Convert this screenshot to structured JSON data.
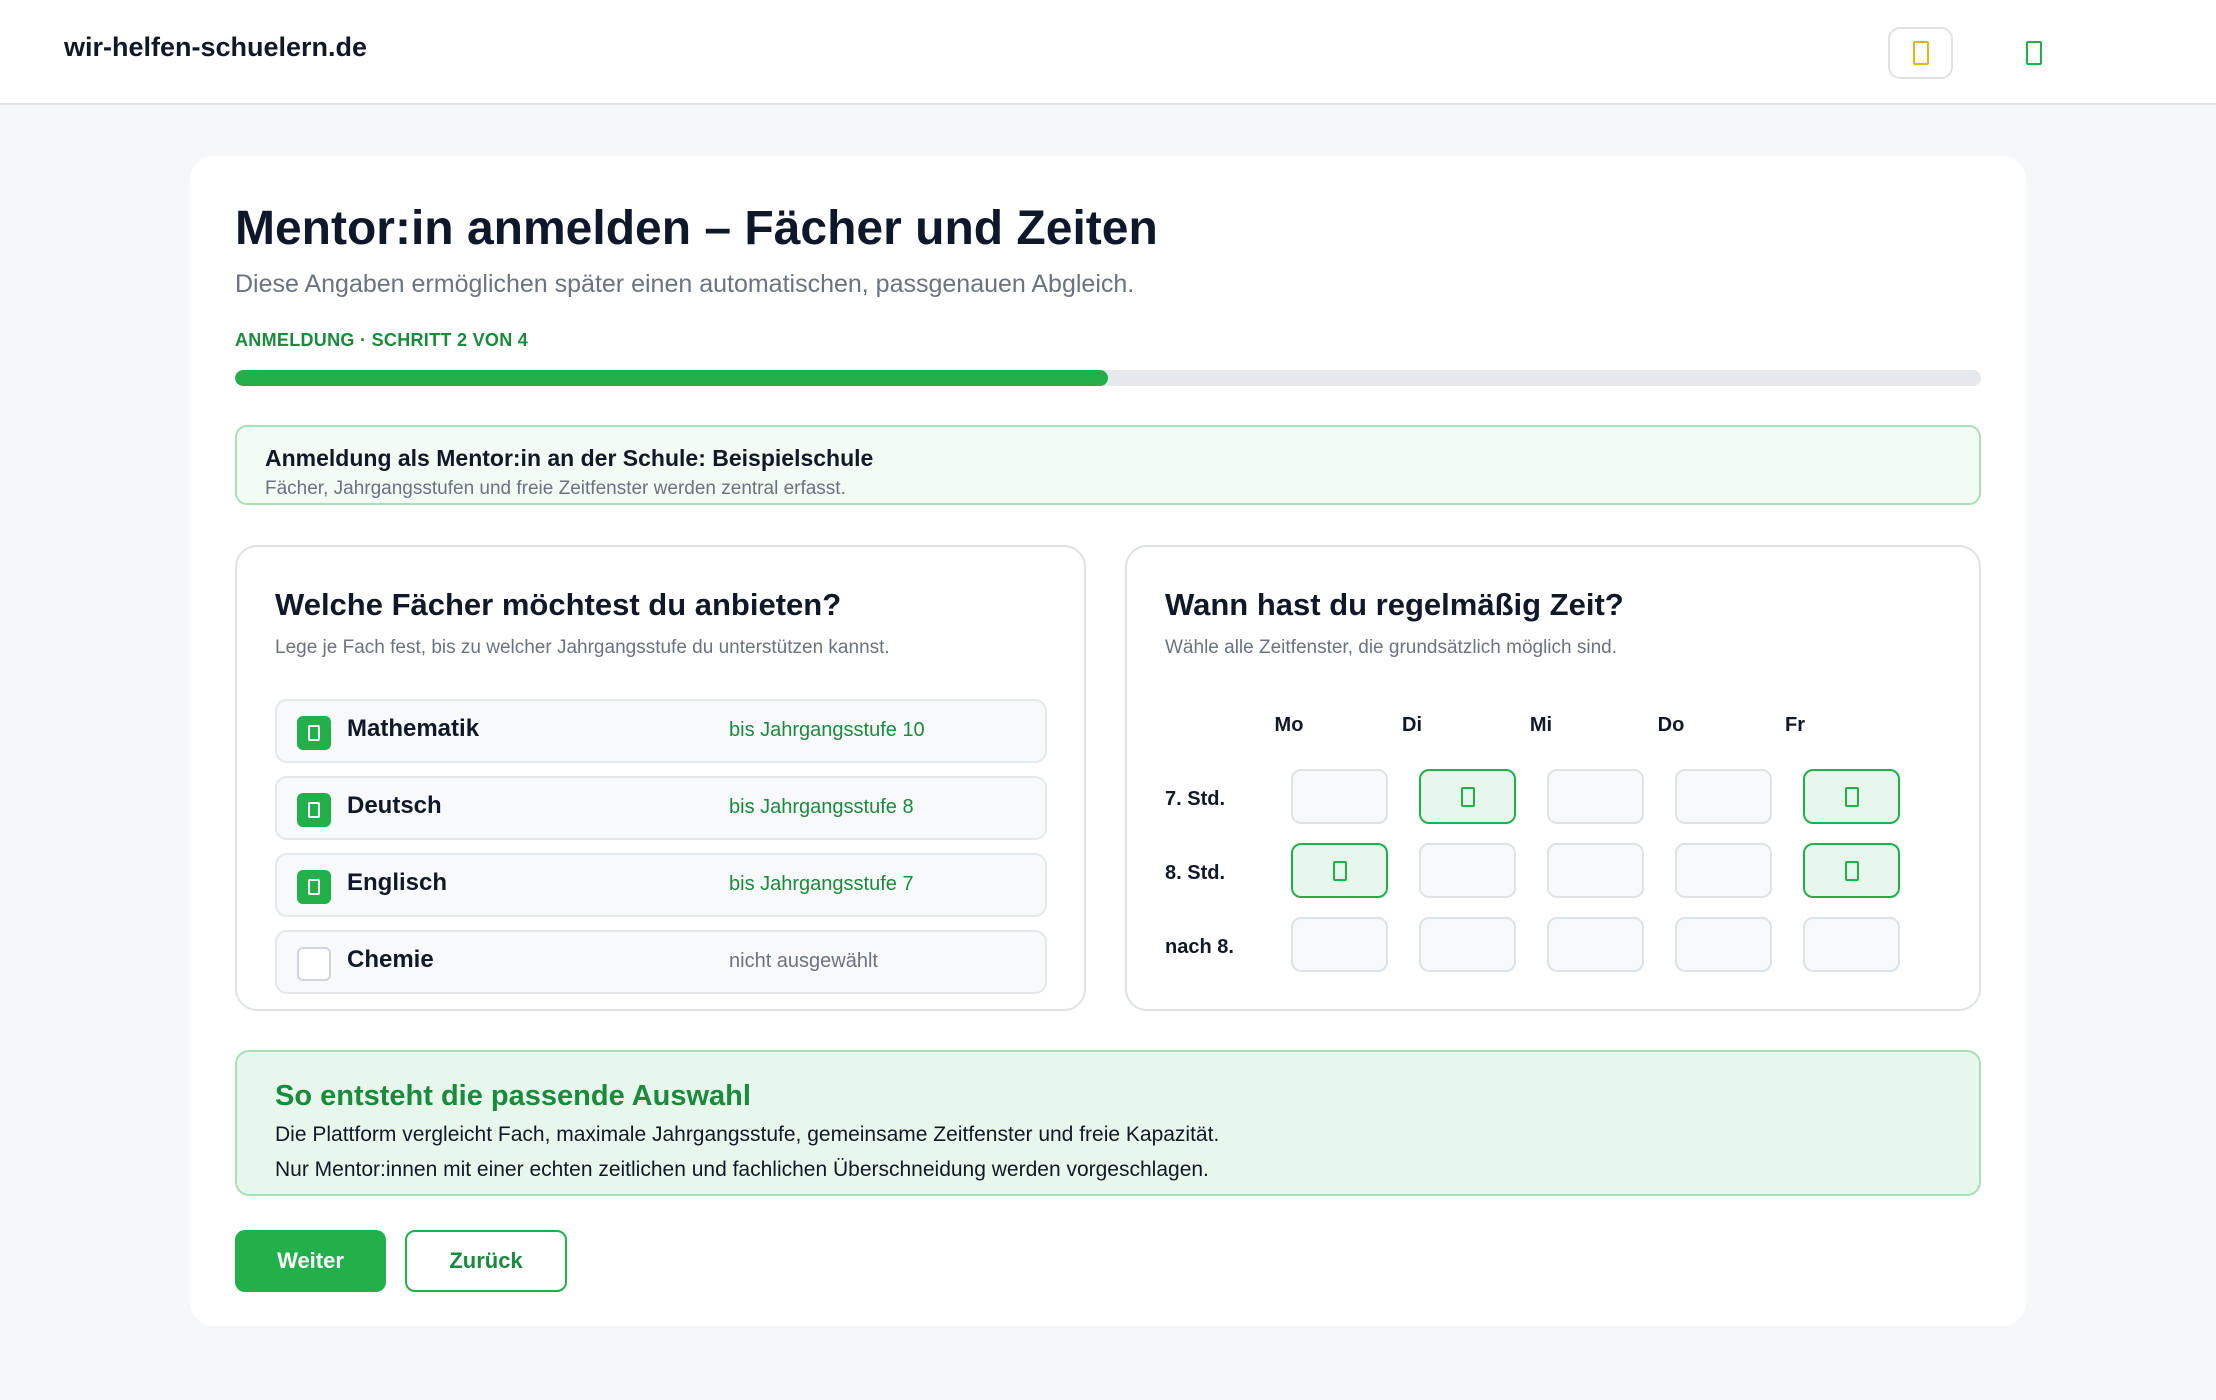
{
  "header": {
    "brand": "wir-helfen-schuelern.de",
    "icons": [
      "theme-toggle-icon",
      "account-icon"
    ]
  },
  "page": {
    "title": "Mentor:in anmelden – Fächer und Zeiten",
    "subtitle": "Diese Angaben ermöglichen später einen automatischen, passgenauen Abgleich.",
    "step_label": "ANMELDUNG · SCHRITT 2 VON 4",
    "progress_percent": 50
  },
  "school_banner": {
    "title": "Anmeldung als Mentor:in an der Schule: Beispielschule",
    "subtitle": "Fächer, Jahrgangsstufen und freie Zeitfenster werden zentral erfasst."
  },
  "subjects_panel": {
    "title": "Welche Fächer möchtest du anbieten?",
    "subtitle": "Lege je Fach fest, bis zu welcher Jahrgangsstufe du unterstützen kannst.",
    "items": [
      {
        "name": "Mathematik",
        "level": "bis Jahrgangsstufe 10",
        "checked": true
      },
      {
        "name": "Deutsch",
        "level": "bis Jahrgangsstufe 8",
        "checked": true
      },
      {
        "name": "Englisch",
        "level": "bis Jahrgangsstufe 7",
        "checked": true
      },
      {
        "name": "Chemie",
        "level": "nicht ausgewählt",
        "checked": false
      }
    ]
  },
  "times_panel": {
    "title": "Wann hast du regelmäßig Zeit?",
    "subtitle": "Wähle alle Zeitfenster, die grundsätzlich möglich sind.",
    "days": [
      "Mo",
      "Di",
      "Mi",
      "Do",
      "Fr"
    ],
    "slots": [
      {
        "label": "7. Std.",
        "selected": [
          false,
          true,
          false,
          false,
          true
        ]
      },
      {
        "label": "8. Std.",
        "selected": [
          true,
          false,
          false,
          false,
          true
        ]
      },
      {
        "label": "nach 8.",
        "selected": [
          false,
          false,
          false,
          false,
          false
        ]
      }
    ]
  },
  "info_box": {
    "title": "So entsteht die passende Auswahl",
    "line1": "Die Plattform vergleicht Fach, maximale Jahrgangsstufe, gemeinsame Zeitfenster und freie Kapazität.",
    "line2": "Nur Mentor:innen mit einer echten zeitlichen und fachlichen Überschneidung werden vorgeschlagen."
  },
  "buttons": {
    "next": "Weiter",
    "back": "Zurück"
  },
  "colors": {
    "accent": "#22b04b",
    "accent_text": "#1a8a3c",
    "accent_bg": "#e8f7ec",
    "theme_icon": "#e2b714"
  }
}
